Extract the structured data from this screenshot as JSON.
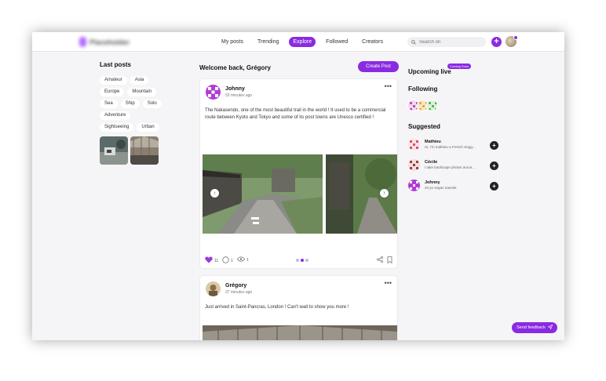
{
  "header": {
    "logo_text": "Placeholder",
    "nav": [
      "My posts",
      "Trending",
      "Explore",
      "Followed",
      "Creators"
    ],
    "active_nav": "Explore",
    "search_placeholder": "Search on"
  },
  "left": {
    "title": "Last posts",
    "tags": [
      "Amateur",
      "Asia",
      "Europe",
      "Mountain",
      "Sea",
      "Ship",
      "Solo",
      "Adventure",
      "Sightseeing",
      "Urban"
    ]
  },
  "feed": {
    "welcome": "Welcome back, Grégory",
    "create_label": "Create Post",
    "posts": [
      {
        "author": "Johnny",
        "time": "33 minutes ago",
        "text": "The Nakasendo, one of the most beautiful trail in the world ! It used to be a commercial route between Kyoto and Tokyo and some of its post towns are Unesco certified !",
        "likes": "11",
        "comments": "1",
        "views": "1",
        "carousel_index": 2,
        "carousel_total": 3
      },
      {
        "author": "Grégory",
        "time": "37 minutes ago",
        "text": "Just arrived in Saint-Pancras, London ! Can't wait to show you more !"
      }
    ]
  },
  "right": {
    "upcoming_title": "Upcoming live",
    "coming_soon": "Coming Soon",
    "following_title": "Following",
    "suggested_title": "Suggested",
    "suggested": [
      {
        "name": "Mathieu",
        "bio": "Hi, I'm mathieu a French vlogg..."
      },
      {
        "name": "Cécile",
        "bio": "I take landscape photos aroun..."
      },
      {
        "name": "Johnny",
        "bio": "23 yo vegan traveler"
      }
    ]
  },
  "feedback_label": "Send feedback",
  "colors": {
    "accent": "#8a2be2",
    "background": "#f5f5f7"
  }
}
